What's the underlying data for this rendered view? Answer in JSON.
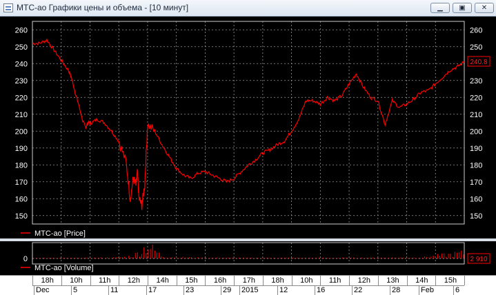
{
  "window": {
    "title": "МТС-ао Графики цены и объема - [10 минут]",
    "buttons": {
      "minimize": "▁",
      "restore": "▣",
      "close": "✕"
    }
  },
  "colors": {
    "background": "#000000",
    "series": "#ff0000",
    "grid": "#9a9a9a",
    "text": "#ffffff"
  },
  "price_panel": {
    "legend": "МТС-ао [Price]",
    "last_value": "240.8",
    "y_ticks": [
      150,
      160,
      170,
      180,
      190,
      200,
      210,
      220,
      230,
      240,
      250,
      260
    ]
  },
  "volume_panel": {
    "legend": "МТС-ао [Volume]",
    "last_value": "2 910",
    "y_tick": "0"
  },
  "time_axis": {
    "hours": [
      "18h",
      "10h",
      "11h",
      "12h",
      "14h",
      "15h",
      "16h",
      "17h",
      "18h",
      "10h",
      "11h",
      "12h",
      "13h",
      "14h",
      "15h"
    ],
    "dates": [
      "Dec",
      "5",
      "11",
      "17",
      "23",
      "29",
      "2015",
      "12",
      "16",
      "22",
      "28",
      "Feb",
      "6"
    ]
  },
  "chart_data": {
    "type": "line",
    "series": [
      {
        "name": "МТС-ао [Price]",
        "x": [
          0,
          5,
          10,
          15,
          20,
          25,
          27,
          30,
          32,
          35,
          37,
          38,
          39,
          41,
          45,
          50,
          55,
          60,
          65,
          68,
          70,
          72,
          73,
          74,
          76,
          78,
          80,
          85,
          90,
          95,
          100,
          105,
          110,
          115,
          120,
          125,
          130,
          135,
          140,
          145,
          150,
          155,
          160,
          165,
          170,
          175,
          180,
          185,
          190,
          195,
          200,
          205,
          210,
          215,
          220,
          225,
          230,
          235,
          240,
          245,
          250,
          255,
          260,
          265,
          270,
          275,
          280,
          285,
          290,
          295,
          300
        ],
        "values": [
          252,
          252,
          254,
          248,
          242,
          236,
          232,
          222,
          216,
          206,
          202,
          204,
          205,
          205,
          207,
          205,
          200,
          194,
          182,
          160,
          172,
          168,
          176,
          160,
          156,
          168,
          204,
          200,
          192,
          185,
          178,
          174,
          172,
          175,
          176,
          174,
          172,
          170,
          172,
          176,
          180,
          183,
          187,
          189,
          192,
          194,
          200,
          207,
          218,
          218,
          216,
          220,
          218,
          221,
          228,
          234,
          226,
          220,
          218,
          204,
          218,
          214,
          216,
          219,
          223,
          224,
          228,
          232,
          236,
          238,
          241
        ]
      },
      {
        "name": "МТС-ао [Volume]",
        "x": [
          0,
          30,
          60,
          65,
          70,
          75,
          80,
          85,
          90,
          100,
          120,
          150,
          180,
          210,
          240,
          270,
          300
        ],
        "values": [
          300,
          250,
          500,
          800,
          1500,
          3500,
          7000,
          4000,
          1200,
          600,
          400,
          300,
          350,
          300,
          400,
          500,
          2910
        ]
      }
    ],
    "x_labels": [
      "18h",
      "10h",
      "11h",
      "12h",
      "14h",
      "15h",
      "16h",
      "17h",
      "18h",
      "10h",
      "11h",
      "12h",
      "13h",
      "14h",
      "15h"
    ],
    "ylim": [
      145,
      265
    ],
    "grid": true
  }
}
